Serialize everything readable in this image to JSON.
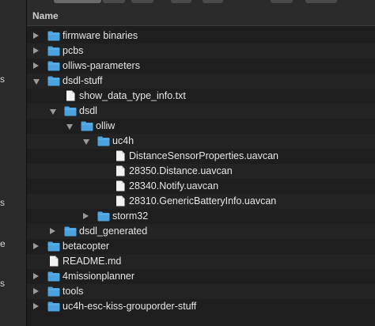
{
  "header": {
    "name_label": "Name"
  },
  "sidebar_fragments": [
    "s",
    "s",
    "e",
    "s"
  ],
  "items": [
    {
      "label": "firmware binaries",
      "type": "folder",
      "expanded": false,
      "level": 0
    },
    {
      "label": "pcbs",
      "type": "folder",
      "expanded": false,
      "level": 0
    },
    {
      "label": "olliws-parameters",
      "type": "folder",
      "expanded": false,
      "level": 0
    },
    {
      "label": "dsdl-stuff",
      "type": "folder",
      "expanded": true,
      "level": 0
    },
    {
      "label": "show_data_type_info.txt",
      "type": "file",
      "level": 1
    },
    {
      "label": "dsdl",
      "type": "folder",
      "expanded": true,
      "level": 1
    },
    {
      "label": "olliw",
      "type": "folder",
      "expanded": true,
      "level": 2
    },
    {
      "label": "uc4h",
      "type": "folder",
      "expanded": true,
      "level": 3
    },
    {
      "label": "DistanceSensorProperties.uavcan",
      "type": "file",
      "level": 4
    },
    {
      "label": "28350.Distance.uavcan",
      "type": "file",
      "level": 4
    },
    {
      "label": "28340.Notify.uavcan",
      "type": "file",
      "level": 4
    },
    {
      "label": "28310.GenericBatteryInfo.uavcan",
      "type": "file",
      "level": 4
    },
    {
      "label": "storm32",
      "type": "folder",
      "expanded": false,
      "level": 3
    },
    {
      "label": "dsdl_generated",
      "type": "folder",
      "expanded": false,
      "level": 1
    },
    {
      "label": "betacopter",
      "type": "folder",
      "expanded": false,
      "level": 0
    },
    {
      "label": "README.md",
      "type": "file",
      "level": 0
    },
    {
      "label": "4missionplanner",
      "type": "folder",
      "expanded": false,
      "level": 0
    },
    {
      "label": "tools",
      "type": "folder",
      "expanded": false,
      "level": 0
    },
    {
      "label": "uc4h-esc-kiss-grouporder-stuff",
      "type": "folder",
      "expanded": false,
      "level": 0
    }
  ],
  "colors": {
    "folder": "#4aa3df",
    "folder_tab": "#67b8ea",
    "file": "#f2f2f2",
    "text": "#e6e6e6",
    "background": "#1e1e1e"
  }
}
